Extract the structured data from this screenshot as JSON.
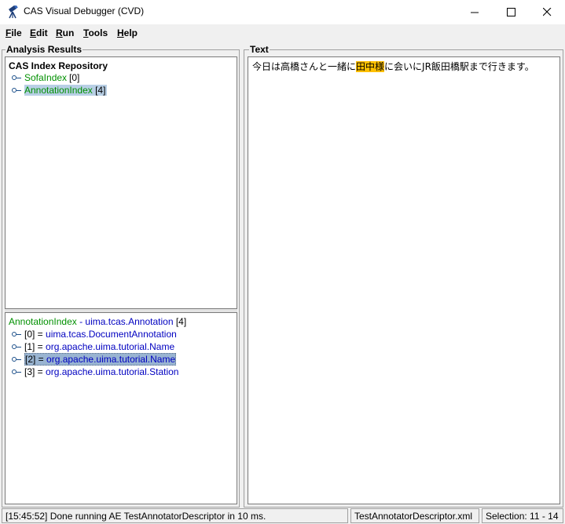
{
  "window": {
    "title": "CAS Visual Debugger (CVD)",
    "minimize_glyph": "—",
    "maximize_glyph": "☐",
    "close_glyph": "✕"
  },
  "menu": [
    "File",
    "Edit",
    "Run",
    "Tools",
    "Help"
  ],
  "analysis": {
    "legend": "Analysis Results",
    "root": "CAS Index Repository",
    "items": [
      {
        "name": "SofaIndex",
        "count": "[0]"
      },
      {
        "name": "AnnotationIndex",
        "count": "[4]"
      }
    ]
  },
  "annotation_panel": {
    "header_index": "AnnotationIndex",
    "header_sep": " - ",
    "header_type": "uima.tcas.Annotation",
    "header_count": " [4]",
    "rows": [
      {
        "idx": "[0] = ",
        "type": "uima.tcas.DocumentAnnotation"
      },
      {
        "idx": "[1] = ",
        "type": "org.apache.uima.tutorial.Name"
      },
      {
        "idx": "[2] = ",
        "type": "org.apache.uima.tutorial.Name"
      },
      {
        "idx": "[3] = ",
        "type": "org.apache.uima.tutorial.Station"
      }
    ]
  },
  "text_panel": {
    "legend": "Text",
    "before": "今日は高橋さんと一緒に",
    "highlight": "田中様",
    "after": "に会いにJR飯田橋駅まで行きます。"
  },
  "status": {
    "message": "[15:45:52]  Done running AE TestAnnotatorDescriptor in 10 ms.",
    "descriptor": "TestAnnotatorDescriptor.xml",
    "selection": "Selection: 11 - 14"
  },
  "colors": {
    "highlight": "#ffc000",
    "index_green": "#009000",
    "type_blue": "#0000c0"
  }
}
